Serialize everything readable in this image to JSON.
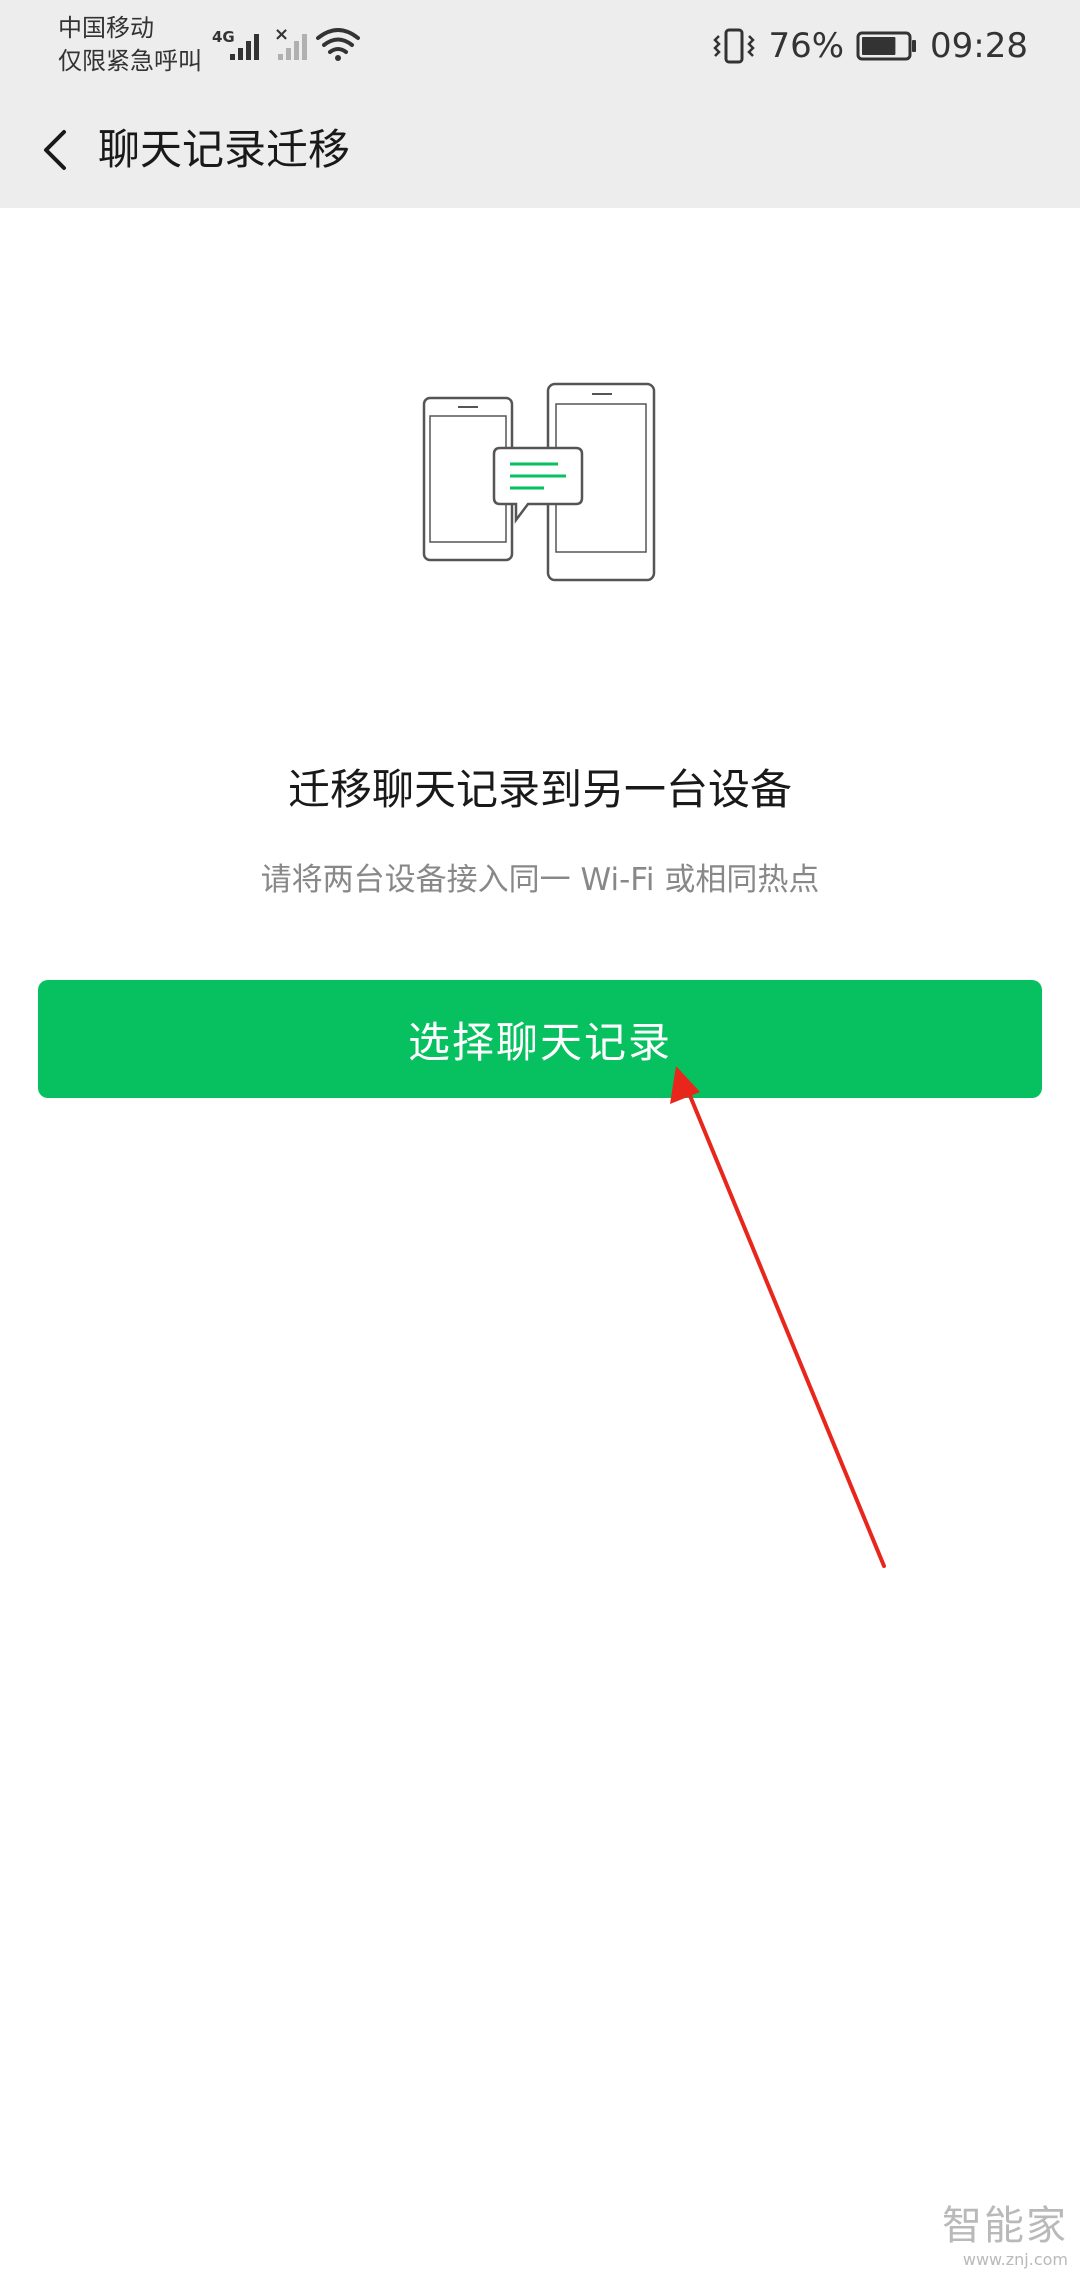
{
  "status_bar": {
    "carrier_line1": "中国移动",
    "carrier_line2": "仅限紧急呼叫",
    "network_type": "4G",
    "battery_percent": "76%",
    "battery_level": 0.76,
    "time": "09:28",
    "icons": [
      "signal-icon",
      "no-signal-icon",
      "wifi-icon",
      "vibrate-icon",
      "battery-icon"
    ]
  },
  "nav": {
    "title": "聊天记录迁移",
    "back_icon": "chevron-left-icon"
  },
  "main": {
    "illustration_icon": "phone-transfer-icon",
    "headline": "迁移聊天记录到另一台设备",
    "subtext": "请将两台设备接入同一 Wi-Fi 或相同热点",
    "button_label": "选择聊天记录"
  },
  "annotation": {
    "arrow_color": "#e8261c"
  },
  "watermark": {
    "text": "智能家",
    "url": "www.znj.com"
  },
  "colors": {
    "accent": "#07c160",
    "header_bg": "#ededed"
  }
}
